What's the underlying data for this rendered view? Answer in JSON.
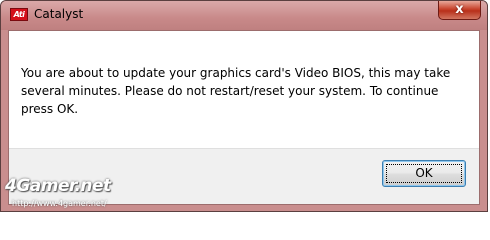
{
  "window": {
    "title": "Catalyst",
    "app_icon_text": "Ati",
    "close_label": "x"
  },
  "dialog": {
    "message": "You are about to update your graphics card's Video BIOS, this may take several minutes.  Please do not restart/reset your system.  To continue press OK.",
    "ok_label": "OK"
  },
  "watermark": {
    "logo_text": "4Gamer.net",
    "url": "http://www.4gamer.net/"
  },
  "colors": {
    "titlebar": "#c98e8e",
    "close_button": "#c7432c",
    "ok_border": "#3c7fb1"
  }
}
